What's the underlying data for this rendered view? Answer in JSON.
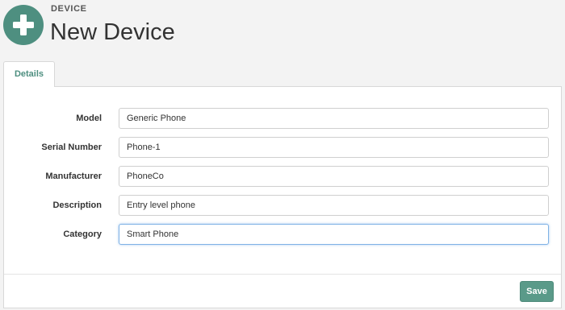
{
  "header": {
    "entity_type": "DEVICE",
    "title": "New Device",
    "icon": "plus-icon"
  },
  "tabs": [
    {
      "label": "Details",
      "active": true
    }
  ],
  "form": {
    "fields": [
      {
        "label": "Model",
        "value": "Generic Phone"
      },
      {
        "label": "Serial Number",
        "value": "Phone-1"
      },
      {
        "label": "Manufacturer",
        "value": "PhoneCo"
      },
      {
        "label": "Description",
        "value": "Entry level phone"
      },
      {
        "label": "Category",
        "value": "Smart Phone",
        "focused": true
      }
    ]
  },
  "actions": {
    "save_label": "Save"
  },
  "colors": {
    "accent": "#4e8f80",
    "button": "#5a9a89",
    "focus": "#7fb2e5"
  }
}
